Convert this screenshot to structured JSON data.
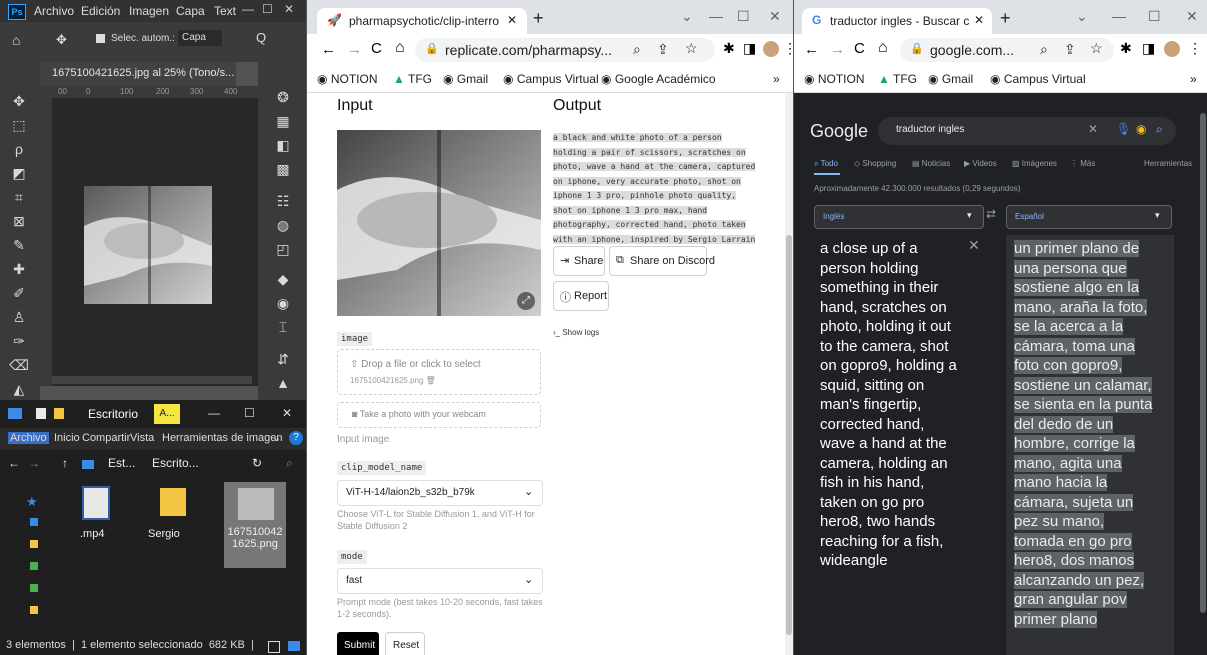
{
  "photoshop": {
    "menu": [
      "Archivo",
      "Edición",
      "Imagen",
      "Capa",
      "Text"
    ],
    "logo": "Ps",
    "options": {
      "auto_select_label": "Selec. autom.:",
      "layer_select": "Capa"
    },
    "doc_tab": "1675100421625.jpg al 25% (Tono/s...",
    "ruler_ticks": [
      "00",
      "0",
      "100",
      "200",
      "300",
      "400"
    ]
  },
  "explorer": {
    "title": "Escritorio",
    "title_badge": "A...",
    "ribbon": [
      "Archivo",
      "Inicio",
      "Compartir",
      "Vista",
      "Herramientas de imagen"
    ],
    "path": [
      "Est...",
      "Escrito..."
    ],
    "items": [
      {
        "name": ".mp4",
        "type": "video"
      },
      {
        "name": "Sergio",
        "type": "folder"
      },
      {
        "name": "1675100421625.png",
        "type": "image"
      }
    ],
    "status": "3 elementos  |  1 elemento seleccionado  682 KB  |"
  },
  "chrome1": {
    "tab_title": "pharmapsychotic/clip-interrogat",
    "url": "replicate.com/pharmapsy...",
    "bookmarks": [
      "NOTION",
      "TFG",
      "Gmail",
      "Campus Virtual",
      "Google Académico"
    ],
    "input_heading": "Input",
    "output_heading": "Output",
    "output_text": "a black and white photo of a person holding a pair of scissors, scratches on photo, wave a hand at the camera, captured on iphone, very accurate photo, shot on iphone 1 3 pro, pinhole photo quality, shot on iphone 1 3 pro max, hand photography, corrected hand, photo taken with an iphone, inspired by Sergio Larrain",
    "share_label": "Share",
    "discord_label": "Share on Discord",
    "report_label": "Report",
    "show_logs": "Show logs",
    "image_field_label": "image",
    "drop_text": "Drop a file or click to select",
    "drop_filename": "1675100421625.png",
    "webcam_text": "Take a photo with your webcam",
    "input_image_caption": "Input image",
    "clip_label": "clip_model_name",
    "clip_value": "ViT-H-14/laion2b_s32b_b79k",
    "clip_help": "Choose ViT-L for Stable Diffusion 1, and ViT-H for Stable Diffusion 2",
    "mode_label": "mode",
    "mode_value": "fast",
    "mode_help": "Prompt mode (best takes 10-20 seconds, fast takes 1-2 seconds).",
    "submit_label": "Submit",
    "reset_label": "Reset"
  },
  "chrome2": {
    "tab_title": "traductor ingles - Buscar con",
    "url": "google.com...",
    "bookmarks": [
      "NOTION",
      "TFG",
      "Gmail",
      "Campus Virtual"
    ],
    "google_logo": "Google",
    "search_query": "traductor ingles",
    "filters": [
      "Todo",
      "Shopping",
      "Noticias",
      "Videos",
      "Imágenes",
      "Más"
    ],
    "tools_label": "Herramientas",
    "results_count": "Aproximadamente 42.300.000 resultados (0,29 segundos)",
    "source_lang": "Inglés",
    "target_lang": "Español",
    "source_text": "a close up of a person holding something in their hand, scratches on photo, holding it out to the camera, shot on gopro9, holding a squid, sitting on man's fingertip, corrected hand, wave a hand at the camera, holding an fish in his hand, taken on go pro hero8, two hands reaching for a fish, wideangle",
    "target_text": "un primer plano de una persona que sostiene algo en la mano, araña la foto, se la acerca a la cámara, toma una foto con gopro9, sostiene un calamar, se sienta en la punta del dedo de un hombre, corrige la mano, agita una mano hacia la cámara, sujeta un pez su mano, tomada en go pro hero8, dos manos alcanzando un pez, gran angular pov primer plano"
  },
  "colors": {
    "ps_bg": "#535353",
    "google_dark": "#202124",
    "translate_highlight": "#5f6368",
    "discord_blue": "#5865f2"
  }
}
